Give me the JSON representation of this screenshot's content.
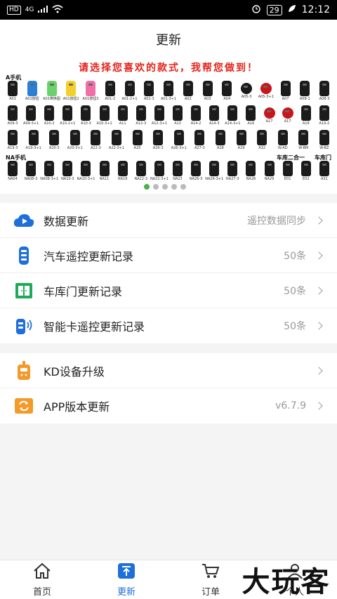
{
  "status_bar": {
    "hd": "HD",
    "network": "4G",
    "battery": "29",
    "time": "12:12"
  },
  "header": {
    "title": "更新"
  },
  "banner": {
    "title": "请选择您喜欢的款式，我帮您做到！",
    "section_a": "A手机",
    "section_na": "NA手机",
    "section_garage2": "车库二合一",
    "section_garage": "车库门",
    "row1": [
      "A01",
      "A01按钮",
      "A01带换图",
      "A01按钮2",
      "A01按钮3",
      "A01-2",
      "A01-2+1",
      "A01-3",
      "A01-3+1",
      "A02",
      "A03",
      "A04",
      "A05-3",
      "A05-3+1",
      "A07",
      "A08-1",
      "A08-3"
    ],
    "row2": [
      "A09-3",
      "A09-3+1",
      "A10-2",
      "A10-2+1",
      "A10-3",
      "A10-3+1",
      "A11",
      "A12-3",
      "A12-3+1",
      "A13",
      "A14-2",
      "A14-3",
      "A14-3+1",
      "A16",
      "A17",
      "A17",
      "A18",
      "A19-2"
    ],
    "row3": [
      "A19-3",
      "A19-3+1",
      "A20-3",
      "A20-3+1",
      "A22-3",
      "A22-3+1",
      "A25",
      "A26-3",
      "A26-3+1",
      "A27-3",
      "A28",
      "A29",
      "A32",
      "W-AD",
      "W-BM",
      "W-BZ"
    ],
    "row4": [
      "NA04",
      "NA08-3",
      "NA08-3+1",
      "NA10-3",
      "NA10-3+1",
      "NA11",
      "NA18",
      "NA22-3",
      "NA22-3+1",
      "NA23",
      "NA26-3",
      "NA26-3+1",
      "NA27-3",
      "NA28",
      "NA29",
      "E01",
      "E02",
      "A31"
    ]
  },
  "list_group_1": [
    {
      "label": "数据更新",
      "value": "遥控数据同步",
      "icon": "cloud-play-icon"
    },
    {
      "label": "汽车遥控更新记录",
      "value": "50条",
      "icon": "car-remote-icon"
    },
    {
      "label": "车库门更新记录",
      "value": "50条",
      "icon": "garage-door-icon"
    },
    {
      "label": "智能卡遥控更新记录",
      "value": "50条",
      "icon": "smart-card-remote-icon"
    }
  ],
  "list_group_2": [
    {
      "label": "KD设备升级",
      "value": "",
      "icon": "kd-device-icon"
    },
    {
      "label": "APP版本更新",
      "value": "v6.7.9",
      "icon": "app-update-icon"
    }
  ],
  "tabbar": [
    {
      "label": "首页",
      "icon": "home-icon"
    },
    {
      "label": "更新",
      "icon": "upload-icon"
    },
    {
      "label": "订单",
      "icon": "cart-icon"
    },
    {
      "label": "个人",
      "icon": "person-icon"
    }
  ],
  "watermark": "大玩客",
  "colors": {
    "accent": "#1e6fd9",
    "banner_red": "#e2231a",
    "orange": "#f39a2b",
    "green": "#1faa59"
  }
}
